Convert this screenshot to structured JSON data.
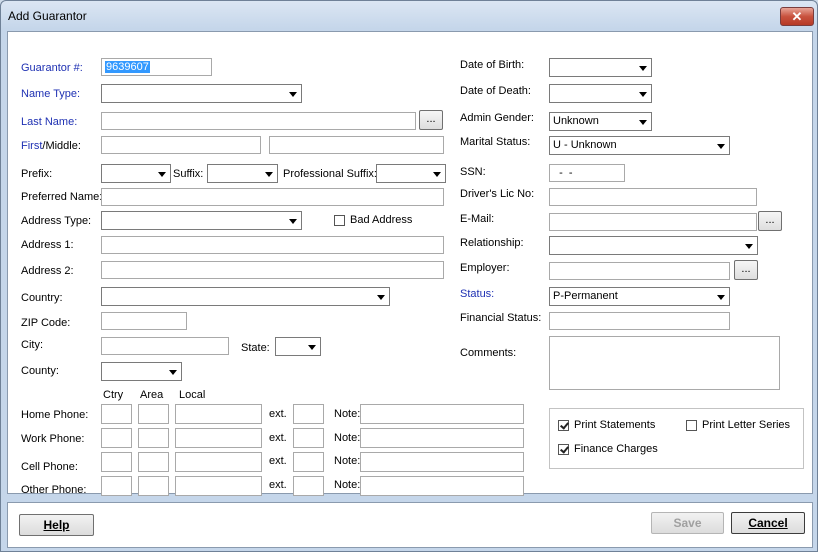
{
  "window": {
    "title": "Add Guarantor",
    "close_glyph": "✕"
  },
  "left": {
    "guarantor_no_label": "Guarantor #:",
    "guarantor_no_value": "9639607",
    "name_type_label": "Name Type:",
    "last_name_label": "Last Name:",
    "first_label": "First",
    "middle_label": "/Middle:",
    "prefix_label": "Prefix:",
    "suffix_label": "Suffix:",
    "prof_suffix_label": "Professional Suffix:",
    "preferred_name_label": "Preferred Name:",
    "address_type_label": "Address Type:",
    "bad_address_label": "Bad Address",
    "address1_label": "Address 1:",
    "address2_label": "Address 2:",
    "country_label": "Country:",
    "zip_label": "ZIP Code:",
    "city_label": "City:",
    "state_label": "State:",
    "county_label": "County:",
    "ellipsis": "...",
    "phone_headers": {
      "ctry": "Ctry",
      "area": "Area",
      "local": "Local"
    },
    "phones": [
      {
        "label": "Home Phone:",
        "ext": "ext.",
        "note": "Note:"
      },
      {
        "label": "Work Phone:",
        "ext": "ext.",
        "note": "Note:"
      },
      {
        "label": "Cell Phone:",
        "ext": "ext.",
        "note": "Note:"
      },
      {
        "label": "Other Phone:",
        "ext": "ext.",
        "note": "Note:"
      }
    ]
  },
  "right": {
    "dob_label": "Date of Birth:",
    "dod_label": "Date of Death:",
    "admin_gender_label": "Admin Gender:",
    "admin_gender_value": "Unknown",
    "marital_status_label": "Marital Status:",
    "marital_status_value": "U - Unknown",
    "ssn_label": "SSN:",
    "ssn_value": "  -  -",
    "drivers_lic_label": "Driver's Lic No:",
    "email_label": "E-Mail:",
    "relationship_label": "Relationship:",
    "employer_label": "Employer:",
    "status_label": "Status:",
    "status_value": "P-Permanent",
    "financial_status_label": "Financial Status:",
    "comments_label": "Comments:",
    "ellipsis": "...",
    "print_statements_label": "Print Statements",
    "print_statements_checked": true,
    "print_letter_series_label": "Print Letter Series",
    "print_letter_series_checked": false,
    "finance_charges_label": "Finance Charges",
    "finance_charges_checked": true
  },
  "buttons": {
    "help": "Help",
    "save": "Save",
    "cancel": "Cancel"
  },
  "colors": {
    "label_blue": "#1f31b3",
    "selection": "#3399ff",
    "close_red": "#c8523e"
  }
}
